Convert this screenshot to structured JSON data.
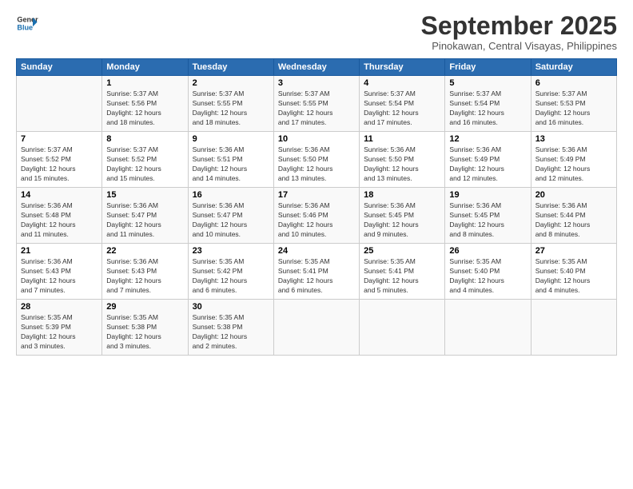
{
  "header": {
    "logo_line1": "General",
    "logo_line2": "Blue",
    "month": "September 2025",
    "location": "Pinokawan, Central Visayas, Philippines"
  },
  "days_of_week": [
    "Sunday",
    "Monday",
    "Tuesday",
    "Wednesday",
    "Thursday",
    "Friday",
    "Saturday"
  ],
  "weeks": [
    [
      {
        "num": "",
        "info": ""
      },
      {
        "num": "1",
        "info": "Sunrise: 5:37 AM\nSunset: 5:56 PM\nDaylight: 12 hours\nand 18 minutes."
      },
      {
        "num": "2",
        "info": "Sunrise: 5:37 AM\nSunset: 5:55 PM\nDaylight: 12 hours\nand 18 minutes."
      },
      {
        "num": "3",
        "info": "Sunrise: 5:37 AM\nSunset: 5:55 PM\nDaylight: 12 hours\nand 17 minutes."
      },
      {
        "num": "4",
        "info": "Sunrise: 5:37 AM\nSunset: 5:54 PM\nDaylight: 12 hours\nand 17 minutes."
      },
      {
        "num": "5",
        "info": "Sunrise: 5:37 AM\nSunset: 5:54 PM\nDaylight: 12 hours\nand 16 minutes."
      },
      {
        "num": "6",
        "info": "Sunrise: 5:37 AM\nSunset: 5:53 PM\nDaylight: 12 hours\nand 16 minutes."
      }
    ],
    [
      {
        "num": "7",
        "info": "Sunrise: 5:37 AM\nSunset: 5:52 PM\nDaylight: 12 hours\nand 15 minutes."
      },
      {
        "num": "8",
        "info": "Sunrise: 5:37 AM\nSunset: 5:52 PM\nDaylight: 12 hours\nand 15 minutes."
      },
      {
        "num": "9",
        "info": "Sunrise: 5:36 AM\nSunset: 5:51 PM\nDaylight: 12 hours\nand 14 minutes."
      },
      {
        "num": "10",
        "info": "Sunrise: 5:36 AM\nSunset: 5:50 PM\nDaylight: 12 hours\nand 13 minutes."
      },
      {
        "num": "11",
        "info": "Sunrise: 5:36 AM\nSunset: 5:50 PM\nDaylight: 12 hours\nand 13 minutes."
      },
      {
        "num": "12",
        "info": "Sunrise: 5:36 AM\nSunset: 5:49 PM\nDaylight: 12 hours\nand 12 minutes."
      },
      {
        "num": "13",
        "info": "Sunrise: 5:36 AM\nSunset: 5:49 PM\nDaylight: 12 hours\nand 12 minutes."
      }
    ],
    [
      {
        "num": "14",
        "info": "Sunrise: 5:36 AM\nSunset: 5:48 PM\nDaylight: 12 hours\nand 11 minutes."
      },
      {
        "num": "15",
        "info": "Sunrise: 5:36 AM\nSunset: 5:47 PM\nDaylight: 12 hours\nand 11 minutes."
      },
      {
        "num": "16",
        "info": "Sunrise: 5:36 AM\nSunset: 5:47 PM\nDaylight: 12 hours\nand 10 minutes."
      },
      {
        "num": "17",
        "info": "Sunrise: 5:36 AM\nSunset: 5:46 PM\nDaylight: 12 hours\nand 10 minutes."
      },
      {
        "num": "18",
        "info": "Sunrise: 5:36 AM\nSunset: 5:45 PM\nDaylight: 12 hours\nand 9 minutes."
      },
      {
        "num": "19",
        "info": "Sunrise: 5:36 AM\nSunset: 5:45 PM\nDaylight: 12 hours\nand 8 minutes."
      },
      {
        "num": "20",
        "info": "Sunrise: 5:36 AM\nSunset: 5:44 PM\nDaylight: 12 hours\nand 8 minutes."
      }
    ],
    [
      {
        "num": "21",
        "info": "Sunrise: 5:36 AM\nSunset: 5:43 PM\nDaylight: 12 hours\nand 7 minutes."
      },
      {
        "num": "22",
        "info": "Sunrise: 5:36 AM\nSunset: 5:43 PM\nDaylight: 12 hours\nand 7 minutes."
      },
      {
        "num": "23",
        "info": "Sunrise: 5:35 AM\nSunset: 5:42 PM\nDaylight: 12 hours\nand 6 minutes."
      },
      {
        "num": "24",
        "info": "Sunrise: 5:35 AM\nSunset: 5:41 PM\nDaylight: 12 hours\nand 6 minutes."
      },
      {
        "num": "25",
        "info": "Sunrise: 5:35 AM\nSunset: 5:41 PM\nDaylight: 12 hours\nand 5 minutes."
      },
      {
        "num": "26",
        "info": "Sunrise: 5:35 AM\nSunset: 5:40 PM\nDaylight: 12 hours\nand 4 minutes."
      },
      {
        "num": "27",
        "info": "Sunrise: 5:35 AM\nSunset: 5:40 PM\nDaylight: 12 hours\nand 4 minutes."
      }
    ],
    [
      {
        "num": "28",
        "info": "Sunrise: 5:35 AM\nSunset: 5:39 PM\nDaylight: 12 hours\nand 3 minutes."
      },
      {
        "num": "29",
        "info": "Sunrise: 5:35 AM\nSunset: 5:38 PM\nDaylight: 12 hours\nand 3 minutes."
      },
      {
        "num": "30",
        "info": "Sunrise: 5:35 AM\nSunset: 5:38 PM\nDaylight: 12 hours\nand 2 minutes."
      },
      {
        "num": "",
        "info": ""
      },
      {
        "num": "",
        "info": ""
      },
      {
        "num": "",
        "info": ""
      },
      {
        "num": "",
        "info": ""
      }
    ]
  ]
}
